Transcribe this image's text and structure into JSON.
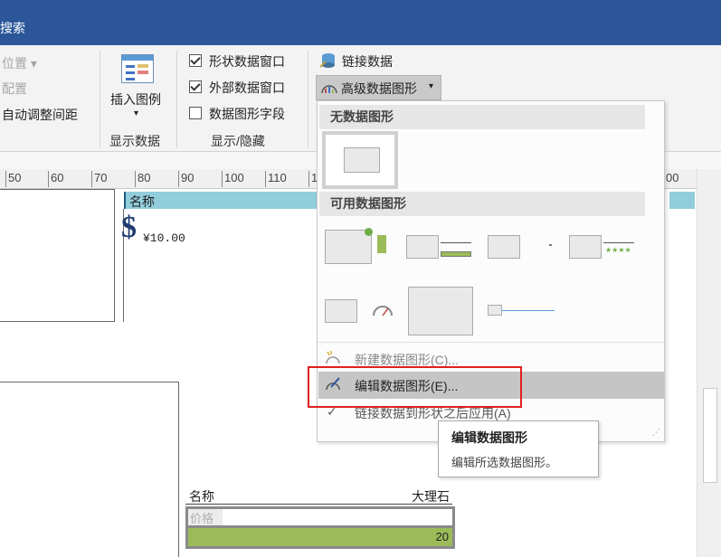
{
  "titlebar": {
    "search_text": "搜索"
  },
  "ribbon": {
    "position_label": "位置",
    "config_label": "配置",
    "auto_spacing_label": "自动调整间距",
    "insert_legend_label": "插入图例",
    "show_data_group": "显示数据",
    "shape_data_window": "形状数据窗口",
    "external_data_window": "外部数据窗口",
    "data_graphic_fields": "数据图形字段",
    "show_hide_group": "显示/隐藏",
    "link_data_label": "链接数据",
    "advanced_data_graphics_label": "高级数据图形"
  },
  "ruler": {
    "ticks": [
      "50",
      "60",
      "70",
      "80",
      "90",
      "100",
      "110",
      "1",
      "00"
    ]
  },
  "canvas": {
    "name_label": "名称",
    "price_value": "¥10.00",
    "shape2_name": "名称",
    "shape2_value": "大理石",
    "shape2_price": "价格",
    "shape2_bar_value": "20"
  },
  "dropdown": {
    "no_graphic_header": "无数据图形",
    "available_header": "可用数据图形",
    "new_graphic": "新建数据图形(C)...",
    "edit_graphic": "编辑数据图形(E)...",
    "apply_after_link": "链接数据到形状之后应用(A)"
  },
  "tooltip": {
    "title": "编辑数据图形",
    "description": "编辑所选数据图形。"
  },
  "colors": {
    "title_bar": "#2b579a",
    "name_strip": "#92cddc",
    "progress_green": "#9bbb59",
    "highlight": "#c5c5c5",
    "red_outline": "#e02020"
  }
}
